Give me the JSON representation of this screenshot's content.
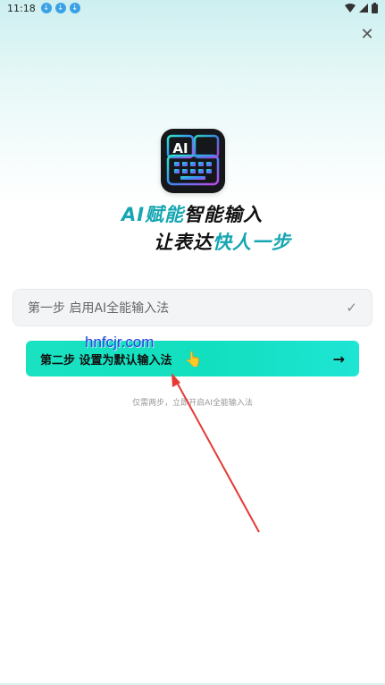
{
  "status_bar": {
    "time": "11:18",
    "download_icons": [
      "download-icon",
      "download-icon",
      "download-icon"
    ],
    "right_icons": [
      "wifi-icon",
      "signal-icon",
      "battery-icon"
    ]
  },
  "close_icon": "close-icon",
  "logo": {
    "text": "AI",
    "icon": "keyboard-icon"
  },
  "headline": {
    "line1_accent": "AI赋能",
    "line1_rest": "智能输入",
    "line2_rest": "让表达",
    "line2_accent": "快人一步"
  },
  "steps": [
    {
      "label": "第一步  启用AI全能输入法",
      "done": true,
      "icon": "check-icon"
    },
    {
      "label": "第二步  设置为默认输入法",
      "done": false,
      "icon": "arrow-right-icon"
    }
  ],
  "hint": "仅需两步，立即开启AI全能输入法",
  "watermark": "hnfcjr.com",
  "colors": {
    "accent": "#15a6b2",
    "step2_gradient_start": "#19e2c1",
    "step2_gradient_end": "#1ee5d4",
    "annotation_arrow": "#e53a35"
  }
}
